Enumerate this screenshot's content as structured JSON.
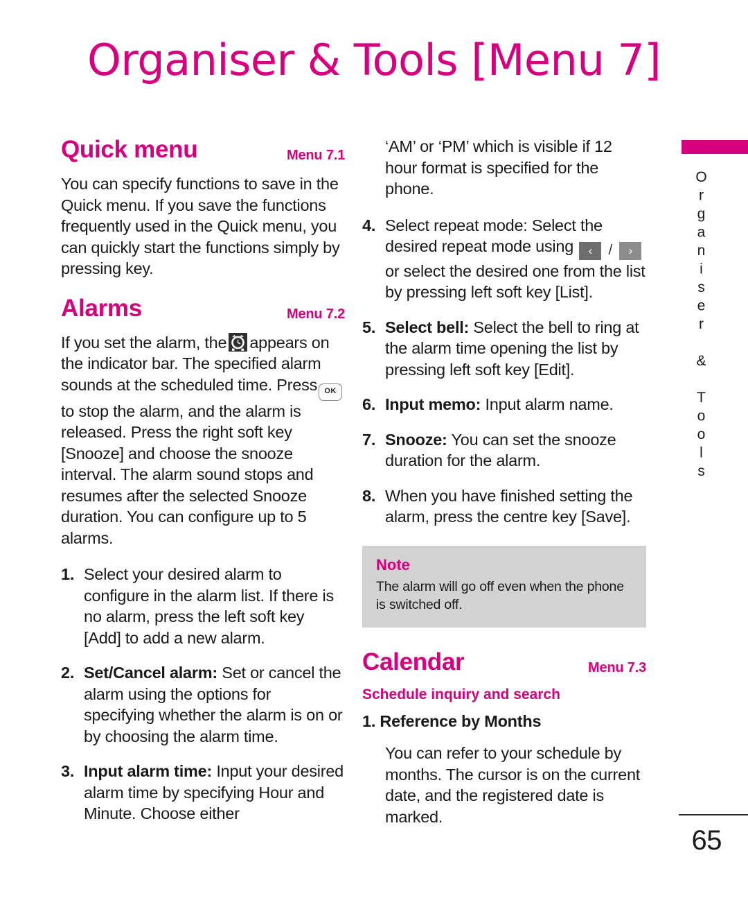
{
  "page": {
    "title": "Organiser & Tools [Menu 7]",
    "number": "65",
    "accent_color": "#D6007F",
    "note_bg_color": "#D2D2D2"
  },
  "side_tab": {
    "label": "Organiser & Tools"
  },
  "left_column": {
    "quick_menu": {
      "title": "Quick menu",
      "menu_no": "Menu 7.1",
      "body": "You can specify functions to save in the Quick menu. If you save the functions frequently used in the Quick menu, you can quickly start the functions simply by pressing key."
    },
    "alarms": {
      "title": "Alarms",
      "menu_no": "Menu 7.2",
      "intro_part1": "If you set the alarm, the",
      "alarm_icon_name": "alarm-clock-icon",
      "intro_part2": "appears on the indicator bar. The specified alarm sounds at the scheduled time. Press",
      "ok_key_label": "OK",
      "intro_part3": "to stop the alarm, and the alarm is released. Press the right soft key [Snooze] and choose the snooze interval. The alarm sound stops and resumes after the selected Snooze duration. You can configure up to 5 alarms.",
      "steps": [
        {
          "num": "1.",
          "lead": "",
          "text": "Select your desired alarm to configure in the alarm list. If there is no alarm, press the left soft key [Add] to add a new alarm."
        },
        {
          "num": "2.",
          "lead": "Set/Cancel alarm:",
          "text": "Set or cancel the alarm using the options for specifying whether the alarm is on or by choosing the alarm time."
        },
        {
          "num": "3.",
          "lead": "Input alarm time:",
          "text": "Input your desired alarm time by specifying Hour and Minute. Choose either"
        }
      ]
    }
  },
  "right_column": {
    "continuation": "‘AM’ or ‘PM’ which is visible if 12 hour format is specified for the phone.",
    "steps": [
      {
        "num": "4.",
        "lead": "",
        "text_before_keys": "Select repeat mode: Select the desired repeat mode using",
        "key_left": "‹",
        "key_slash": "/",
        "key_right": "›",
        "text_after_keys": "or select the desired one from the list by pressing left soft key [List]."
      },
      {
        "num": "5.",
        "lead": "Select bell:",
        "text": "Select the bell to ring at the alarm time opening the list by pressing left soft key [Edit]."
      },
      {
        "num": "6.",
        "lead": "Input memo:",
        "text": "Input alarm name."
      },
      {
        "num": "7.",
        "lead": "Snooze:",
        "text": "You can set the snooze duration for the alarm."
      },
      {
        "num": "8.",
        "lead": "",
        "text": "When you have finished setting the alarm, press the centre key [Save]."
      }
    ],
    "note": {
      "title": "Note",
      "text": "The alarm will go off even when the phone is switched off."
    },
    "calendar": {
      "title": "Calendar",
      "menu_no": "Menu 7.3",
      "sub_head": "Schedule inquiry and search",
      "item_title": "1. Reference by Months",
      "item_body": "You can refer to your schedule by months. The cursor is on the current date, and the registered date is marked."
    }
  }
}
